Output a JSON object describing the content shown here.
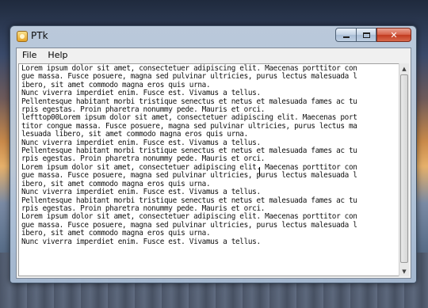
{
  "window": {
    "title": "PTk"
  },
  "menu": {
    "items": [
      {
        "label": "File"
      },
      {
        "label": "Help"
      }
    ]
  },
  "editor": {
    "lines": [
      "Lorem ipsum dolor sit amet, consectetuer adipiscing elit. Maecenas porttitor con",
      "gue massa. Fusce posuere, magna sed pulvinar ultricies, purus lectus malesuada l",
      "ibero, sit amet commodo magna eros quis urna.",
      "Nunc viverra imperdiet enim. Fusce est. Vivamus a tellus.",
      "Pellentesque habitant morbi tristique senectus et netus et malesuada fames ac tu",
      "rpis egestas. Proin pharetra nonummy pede. Mauris et orci.",
      "lefttop00Lorem ipsum dolor sit amet, consectetuer adipiscing elit. Maecenas port",
      "titor congue massa. Fusce posuere, magna sed pulvinar ultricies, purus lectus ma",
      "lesuada libero, sit amet commodo magna eros quis urna.",
      "Nunc viverra imperdiet enim. Fusce est. Vivamus a tellus.",
      "Pellentesque habitant morbi tristique senectus et netus et malesuada fames ac tu",
      "rpis egestas. Proin pharetra nonummy pede. Mauris et orci.",
      "Lorem ipsum dolor sit amet, consectetuer adipiscing elit. Maecenas porttitor con",
      "gue massa. Fusce posuere, magna sed pulvinar ultricies, purus lectus malesuada l",
      "ibero, sit amet commodo magna eros quis urna.",
      "Nunc viverra imperdiet enim. Fusce est. Vivamus a tellus.",
      "Pellentesque habitant morbi tristique senectus et netus et malesuada fames ac tu",
      "rpis egestas. Proin pharetra nonummy pede. Mauris et orci.",
      "Lorem ipsum dolor sit amet, consectetuer adipiscing elit. Maecenas porttitor con",
      "gue massa. Fusce posuere, magna sed pulvinar ultricies, purus lectus malesuada l",
      "ibero, sit amet commodo magna eros quis urna.",
      "Nunc viverra imperdiet enim. Fusce est. Vivamus a tellus."
    ]
  },
  "icons": {
    "app": "ptk-app-icon",
    "minimize": "minimize-icon",
    "maximize": "maximize-icon",
    "close": "close-icon",
    "scroll_up": "scroll-up-arrow-icon",
    "scroll_down": "scroll-down-arrow-icon"
  },
  "colors": {
    "close_button": "#c13a1f",
    "window_frame": "#aabed6",
    "text_background": "#ffffff"
  }
}
